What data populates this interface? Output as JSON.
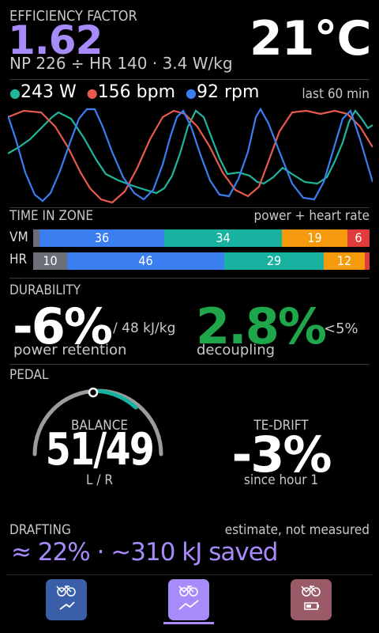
{
  "ef": {
    "label": "EFFICIENCY FACTOR",
    "value": "1.62",
    "detail": "NP 226 ÷ HR 140 · 3.4 W/kg"
  },
  "temp": "21°C",
  "live": {
    "power": "243 W",
    "hr": "156 bpm",
    "cadence": "92 rpm",
    "window": "last 60 min"
  },
  "colors": {
    "power": "#20b69d",
    "hr": "#e85a4f",
    "cadence": "#3a7ef0",
    "accent": "#a78bfa",
    "good": "#1fa64a",
    "z1": "#6b6f78",
    "z2": "#3a7ef0",
    "z3": "#17b3a0",
    "z4": "#f59a0c",
    "z5": "#e23b3b"
  },
  "zones": {
    "label": "TIME IN ZONE",
    "sub": "power + heart rate",
    "rows": [
      {
        "name": "VM",
        "segs": [
          {
            "pct": 2,
            "label": ""
          },
          {
            "pct": 36,
            "label": "36"
          },
          {
            "pct": 34,
            "label": "34"
          },
          {
            "pct": 19,
            "label": "19"
          },
          {
            "pct": 6,
            "label": "6"
          }
        ]
      },
      {
        "name": "HR",
        "segs": [
          {
            "pct": 10,
            "label": "10"
          },
          {
            "pct": 46,
            "label": "46"
          },
          {
            "pct": 29,
            "label": "29"
          },
          {
            "pct": 12,
            "label": "12"
          },
          {
            "pct": 3,
            "label": ""
          }
        ]
      }
    ]
  },
  "durability": {
    "label": "DURABILITY",
    "retention": "-6%",
    "retention_unit": "/ 48 kJ/kg",
    "retention_label": "power retention",
    "decoupling": "2.8%",
    "decoupling_target": "<5%",
    "decoupling_label": "decoupling"
  },
  "pedal": {
    "label": "PEDAL",
    "balance_label": "BALANCE",
    "balance": "51/49",
    "balance_sub": "L / R",
    "tedrift_label": "TE-DRIFT",
    "tedrift": "-3%",
    "tedrift_sub": "since hour 1"
  },
  "drafting": {
    "label": "DRAFTING",
    "note": "estimate, not measured",
    "value": "≈ 22% · ~310 kJ saved"
  },
  "nav": {
    "tabs": [
      {
        "name": "efficiency",
        "active": false
      },
      {
        "name": "trends",
        "active": true
      },
      {
        "name": "battery",
        "active": false
      }
    ]
  }
}
